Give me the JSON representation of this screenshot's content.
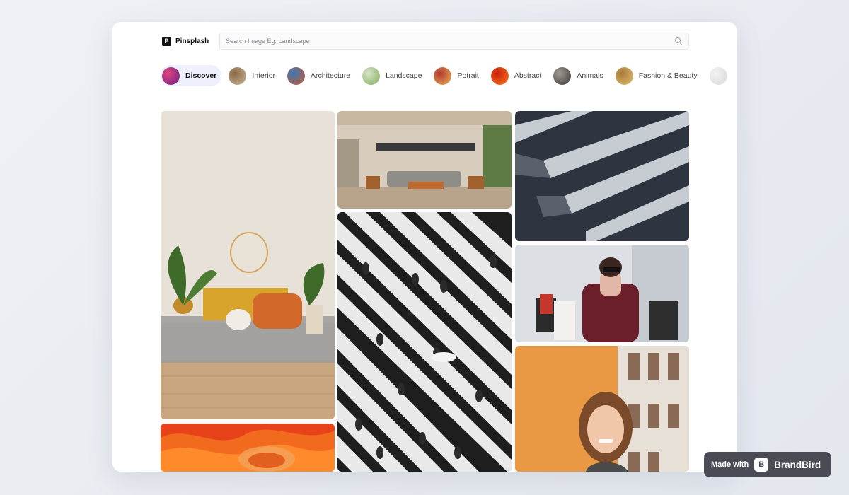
{
  "app": {
    "logo_letter": "P",
    "name": "Pinsplash"
  },
  "search": {
    "placeholder": "Search Image Eg. Landscape",
    "value": ""
  },
  "categories": [
    {
      "label": "Discover",
      "active": true,
      "thumb_colors": [
        "#6b1e8a",
        "#e0457b"
      ]
    },
    {
      "label": "Interior",
      "active": false,
      "thumb_colors": [
        "#c9b79c",
        "#8a6a45"
      ]
    },
    {
      "label": "Architecture",
      "active": false,
      "thumb_colors": [
        "#c9562e",
        "#3d79b5"
      ]
    },
    {
      "label": "Landscape",
      "active": false,
      "thumb_colors": [
        "#7fae5a",
        "#d8e3c8"
      ]
    },
    {
      "label": "Potrait",
      "active": false,
      "thumb_colors": [
        "#e8b45a",
        "#b2382f"
      ]
    },
    {
      "label": "Abstract",
      "active": false,
      "thumb_colors": [
        "#ff7a1a",
        "#c81f0f"
      ]
    },
    {
      "label": "Animals",
      "active": false,
      "thumb_colors": [
        "#3a3a3a",
        "#a09a90"
      ]
    },
    {
      "label": "Fashion & Beauty",
      "active": false,
      "thumb_colors": [
        "#e2c070",
        "#a87a3a"
      ]
    },
    {
      "label": "",
      "active": false,
      "thumb_colors": [
        "#d8d8d8",
        "#f2f2f2"
      ]
    }
  ],
  "images": [
    {
      "name": "photo-interior-living-room",
      "alt": "Interior"
    },
    {
      "name": "photo-abstract-orange",
      "alt": "Abstract"
    },
    {
      "name": "photo-modern-living-room",
      "alt": "Interior"
    },
    {
      "name": "photo-crosswalk-crowd",
      "alt": "Crosswalk"
    },
    {
      "name": "photo-architecture-facade",
      "alt": "Architecture"
    },
    {
      "name": "photo-fashion-shopping",
      "alt": "Fashion"
    },
    {
      "name": "photo-portrait-woman",
      "alt": "Portrait"
    }
  ],
  "badge": {
    "made_with": "Made with",
    "brand": "BrandBird",
    "brand_icon": "B"
  }
}
